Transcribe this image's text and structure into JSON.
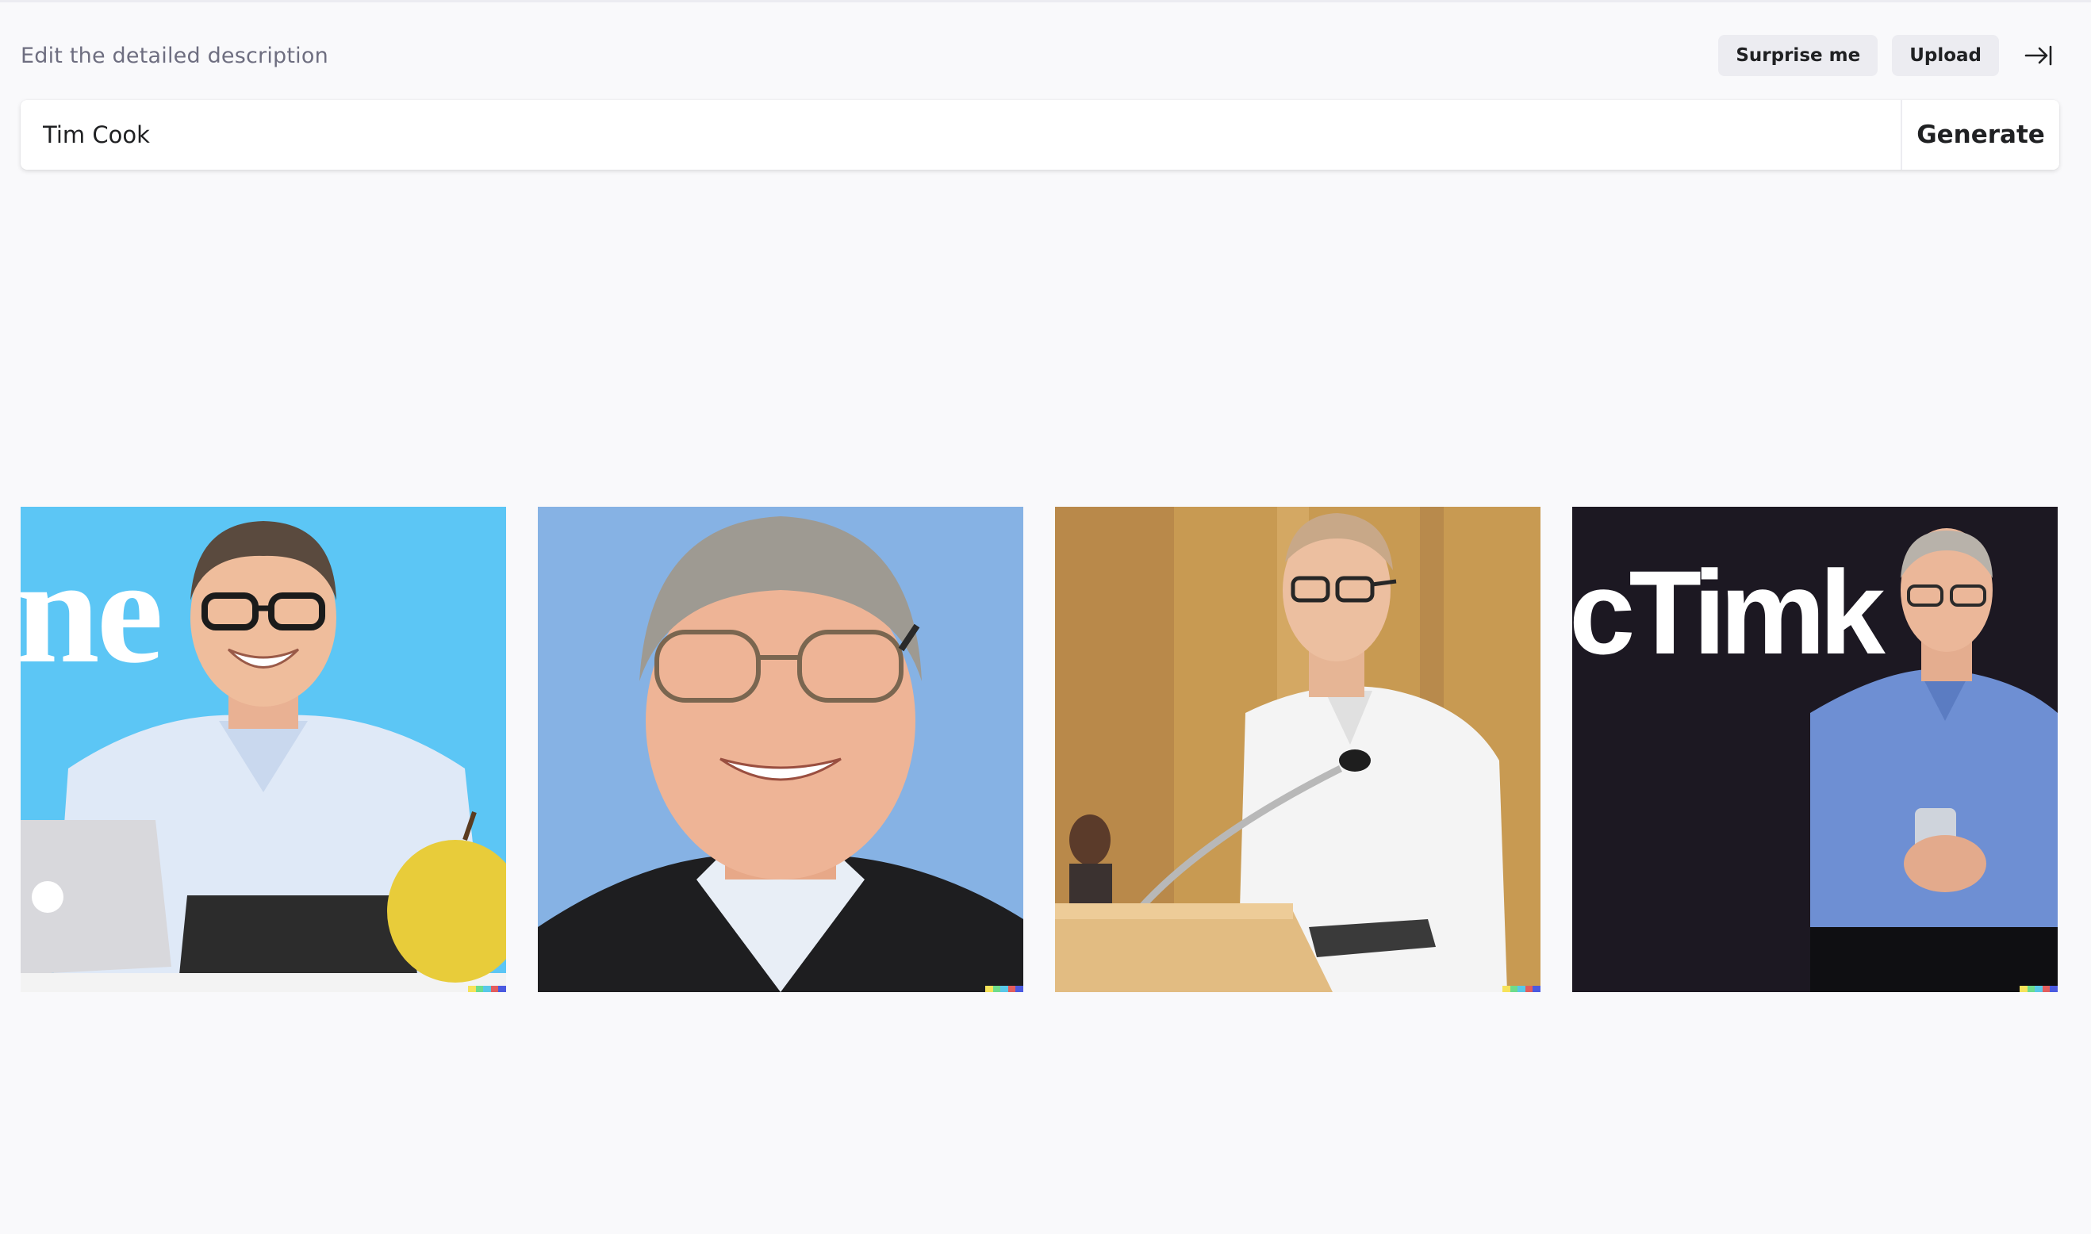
{
  "header": {
    "hint": "Edit the detailed description",
    "surprise_label": "Surprise me",
    "upload_label": "Upload",
    "collapse_icon": "arrow-right-to-bar-icon"
  },
  "prompt": {
    "value": "Tim Cook",
    "generate_label": "Generate"
  },
  "images": [
    {
      "name": "generated-image-1",
      "overlay_text": "ne Ip",
      "background": "#5cc6f5"
    },
    {
      "name": "generated-image-2",
      "overlay_text": "",
      "background": "#86b2e4"
    },
    {
      "name": "generated-image-3",
      "overlay_text": "",
      "background": "#c89a52"
    },
    {
      "name": "generated-image-4",
      "overlay_text": "cTimk",
      "background": "#1c1822"
    }
  ],
  "signature_colors": [
    "#f6e35a",
    "#6ddc8c",
    "#58c8e8",
    "#e35d5d",
    "#4b5ae0"
  ]
}
